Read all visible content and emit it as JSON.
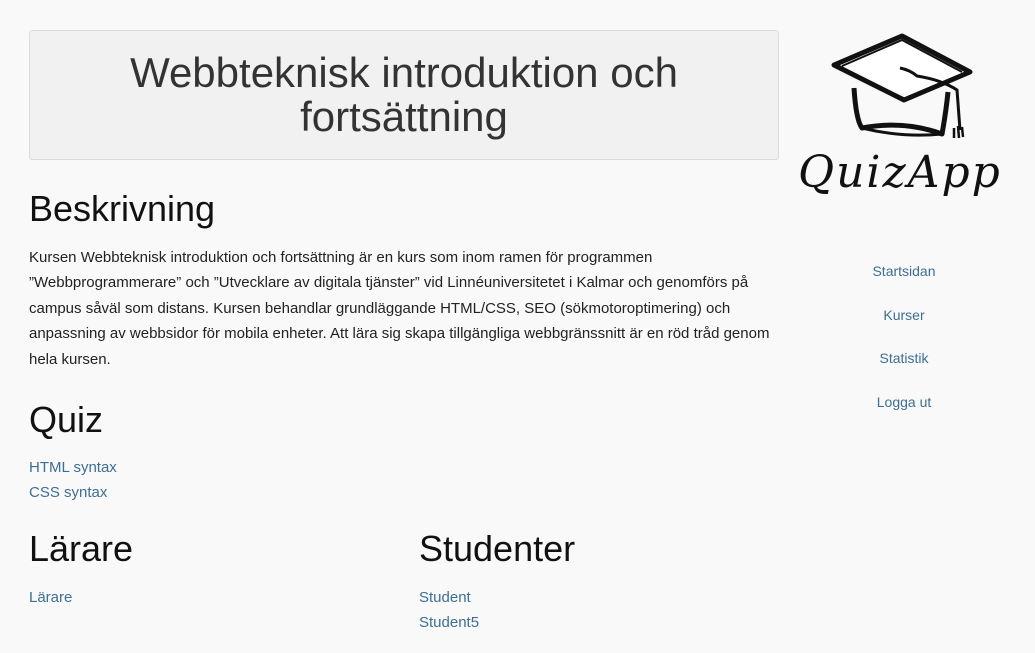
{
  "header": {
    "title": "Webbteknisk introduktion och fortsättning"
  },
  "logo": {
    "text": "QuizApp"
  },
  "nav": {
    "items": [
      {
        "label": "Startsidan"
      },
      {
        "label": "Kurser"
      },
      {
        "label": "Statistik"
      },
      {
        "label": "Logga ut"
      }
    ]
  },
  "description": {
    "heading": "Beskrivning",
    "text": "Kursen Webbteknisk introduktion och fortsättning är en kurs som inom ramen för programmen ”Webbprogrammerare” och ”Utvecklare av digitala tjänster” vid Linnéuniversitetet i Kalmar och genomförs på campus såväl som distans. Kursen behandlar grundläggande HTML/CSS, SEO (sökmotoroptimering) och anpassning av webbsidor för mobila enheter. Att lära sig skapa tillgängliga webbgränssnitt är en röd tråd genom hela kursen."
  },
  "quiz": {
    "heading": "Quiz",
    "items": [
      {
        "label": "HTML syntax"
      },
      {
        "label": "CSS syntax"
      }
    ]
  },
  "teachers": {
    "heading": "Lärare",
    "items": [
      {
        "label": "Lärare"
      }
    ]
  },
  "students": {
    "heading": "Studenter",
    "items": [
      {
        "label": "Student"
      },
      {
        "label": "Student5"
      }
    ]
  },
  "colors": {
    "link": "#3d6f94",
    "background": "#f9f9f9",
    "header_bg": "#f1f1f1"
  }
}
